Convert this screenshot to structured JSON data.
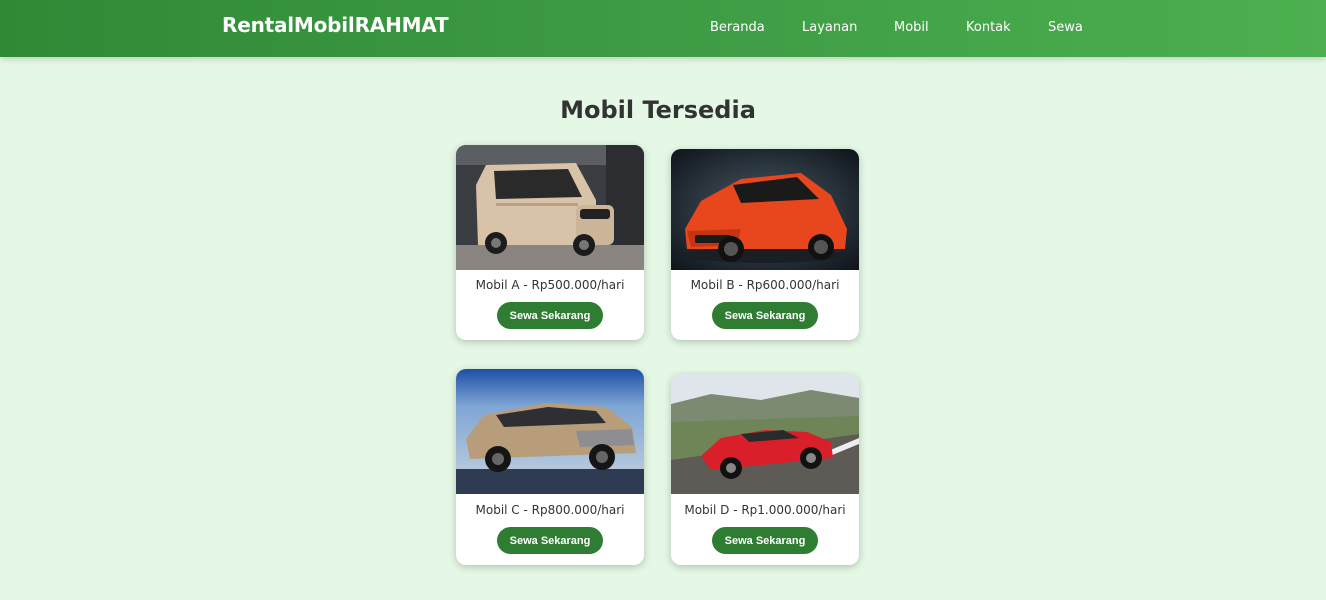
{
  "brand": "RentalMobilRAHMAT",
  "nav": [
    {
      "label": "Beranda"
    },
    {
      "label": "Layanan"
    },
    {
      "label": "Mobil"
    },
    {
      "label": "Kontak"
    },
    {
      "label": "Sewa"
    }
  ],
  "page_title": "Mobil Tersedia",
  "cars": [
    {
      "caption": "Mobil A - Rp500.000/hari",
      "button_label": "Sewa Sekarang"
    },
    {
      "caption": "Mobil B - Rp600.000/hari",
      "button_label": "Sewa Sekarang"
    },
    {
      "caption": "Mobil C - Rp800.000/hari",
      "button_label": "Sewa Sekarang"
    },
    {
      "caption": "Mobil D - Rp1.000.000/hari",
      "button_label": "Sewa Sekarang"
    }
  ],
  "colors": {
    "nav_start": "#2f8a36",
    "nav_end": "#4caf50",
    "page_bg": "#e4f8e5",
    "button": "#2e7d32"
  }
}
